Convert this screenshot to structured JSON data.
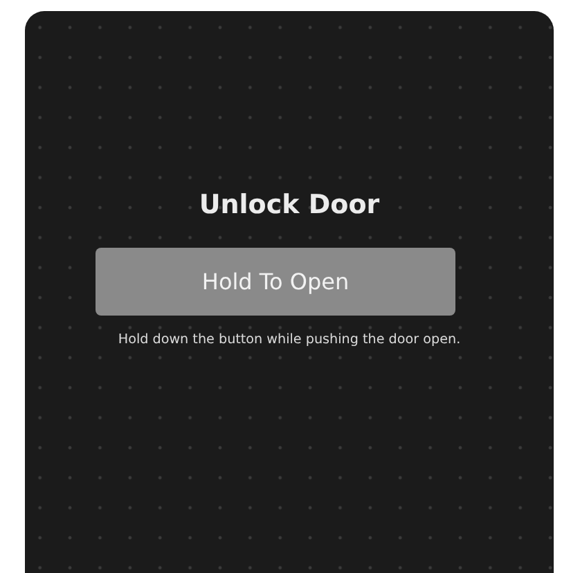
{
  "title": "Unlock Door",
  "button": {
    "label": "Hold To Open"
  },
  "hint": "Hold down the button while pushing the door open."
}
